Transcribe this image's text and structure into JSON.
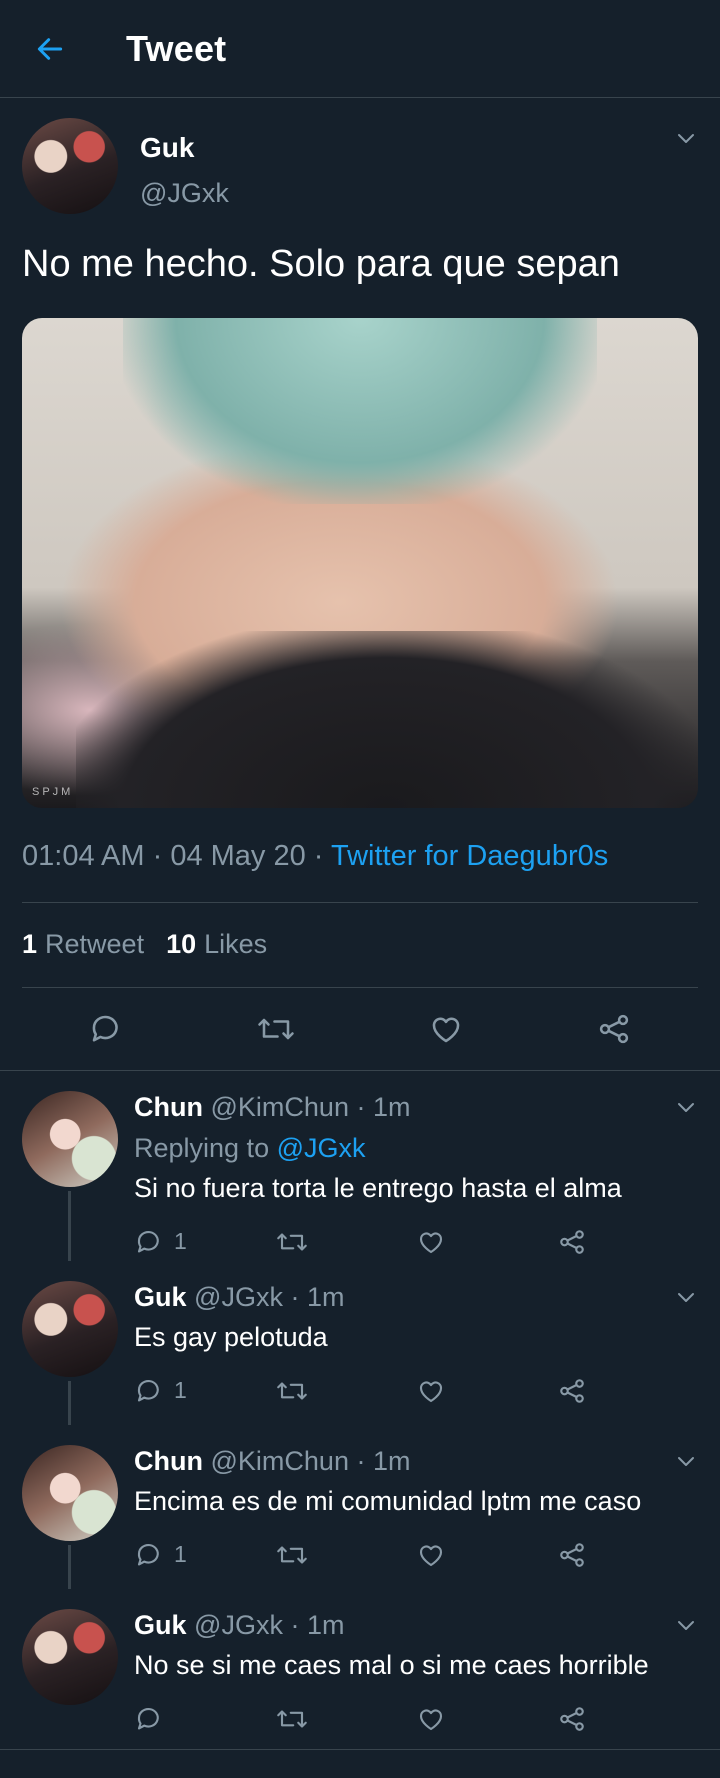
{
  "header": {
    "title": "Tweet"
  },
  "tweet": {
    "author_name": "Guk",
    "author_handle": "@JGxk",
    "text": "No me hecho. Solo para que sepan",
    "media_watermark": "SPJM",
    "time": "01:04 AM",
    "date": "04 May 20",
    "source": "Twitter for Daegubr0s",
    "retweet_count": "1",
    "retweet_label": "Retweet",
    "like_count": "10",
    "like_label": "Likes"
  },
  "replies": [
    {
      "name": "Chun",
      "handle": "@KimChun",
      "time": "1m",
      "replying_prefix": "Replying to",
      "replying_to": "@JGxk",
      "text": "Si no fuera torta le entrego hasta el alma",
      "reply_count": "1"
    },
    {
      "name": "Guk",
      "handle": "@JGxk",
      "time": "1m",
      "text": "Es gay pelotuda",
      "reply_count": "1"
    },
    {
      "name": "Chun",
      "handle": "@KimChun",
      "time": "1m",
      "text": "Encima es de mi comunidad lptm me caso",
      "reply_count": "1"
    },
    {
      "name": "Guk",
      "handle": "@JGxk",
      "time": "1m",
      "text": "No se si me caes mal o si me caes horrible",
      "reply_count": ""
    }
  ],
  "colors": {
    "background": "#15202b",
    "accent": "#1da1f2",
    "muted": "#8899a6",
    "divider": "#38444d"
  },
  "icons": [
    "back-arrow-icon",
    "chevron-down-icon",
    "reply-icon",
    "retweet-icon",
    "like-icon",
    "share-icon"
  ]
}
